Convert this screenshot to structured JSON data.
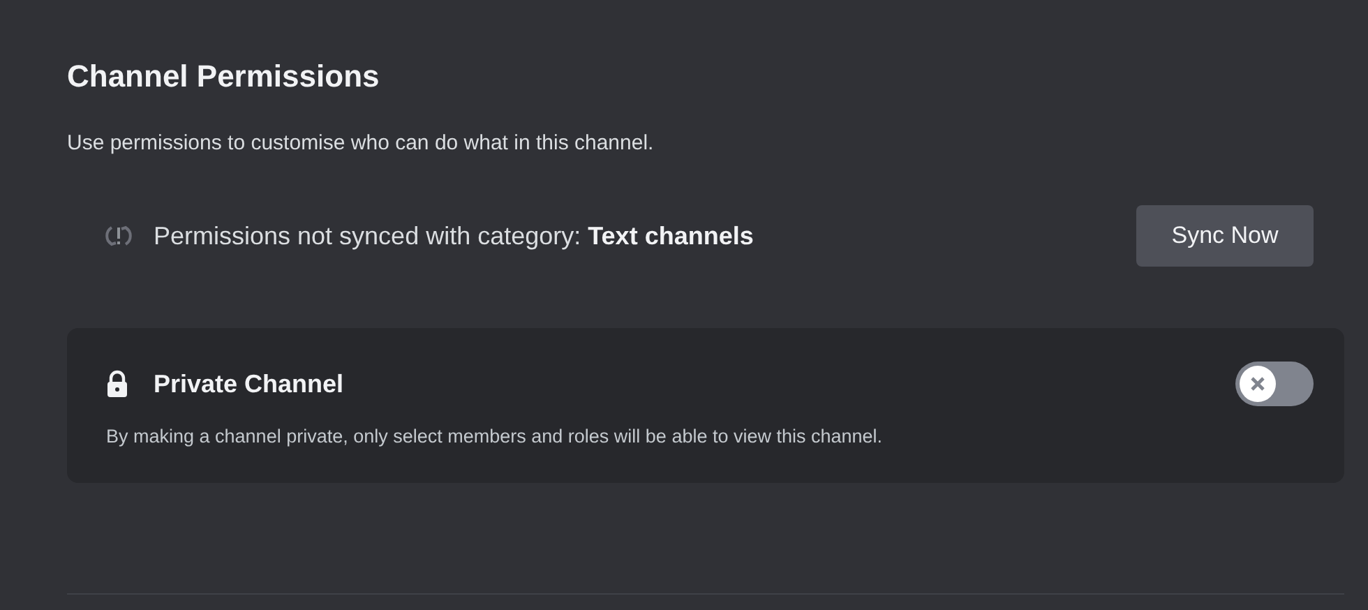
{
  "title": "Channel Permissions",
  "description": "Use permissions to customise who can do what in this channel.",
  "sync": {
    "message": "Permissions not synced with category: **Text channels**",
    "button": "Sync Now"
  },
  "private_channel": {
    "title": "Private Channel",
    "on": false,
    "description": "By making a channel private, only select members and roles will be able to view this channel."
  }
}
